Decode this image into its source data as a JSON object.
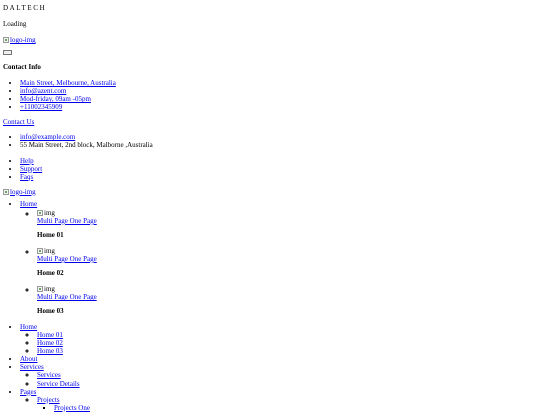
{
  "brand": {
    "name": "DALTECH"
  },
  "preloader": {
    "text": "Loading"
  },
  "logo": {
    "alt": "logo-img"
  },
  "contact_info": {
    "title": "Contact Info",
    "items": [
      "Main Street, Melbourne, Australia",
      "info@azent.com",
      "Mod-friday, 09am -05pm",
      "+11002345909"
    ]
  },
  "contact_us": {
    "label": "Contact Us"
  },
  "footer_contact": {
    "email": "info@example.com",
    "address": "55 Main Street, 2nd block, Malborne ,Australia"
  },
  "help_links": [
    "Help",
    "Support",
    "Faqs"
  ],
  "mega_menu": {
    "home_label": "Home",
    "items": [
      {
        "img_alt": "img",
        "link": "Multi Page One Page",
        "title": "Home 01"
      },
      {
        "img_alt": "img",
        "link": "Multi Page One Page",
        "title": "Home 02"
      },
      {
        "img_alt": "img",
        "link": "Multi Page One Page",
        "title": "Home 03"
      }
    ]
  },
  "main_nav": {
    "home": {
      "label": "Home",
      "children": [
        "Home 01",
        "Home 02",
        "Home 03"
      ]
    },
    "about": "About",
    "services": {
      "label": "Services",
      "children": [
        "Services",
        "Service Details"
      ]
    },
    "pages": {
      "label": "Pages",
      "projects": {
        "label": "Projects",
        "children": [
          "Projects One"
        ]
      }
    }
  }
}
